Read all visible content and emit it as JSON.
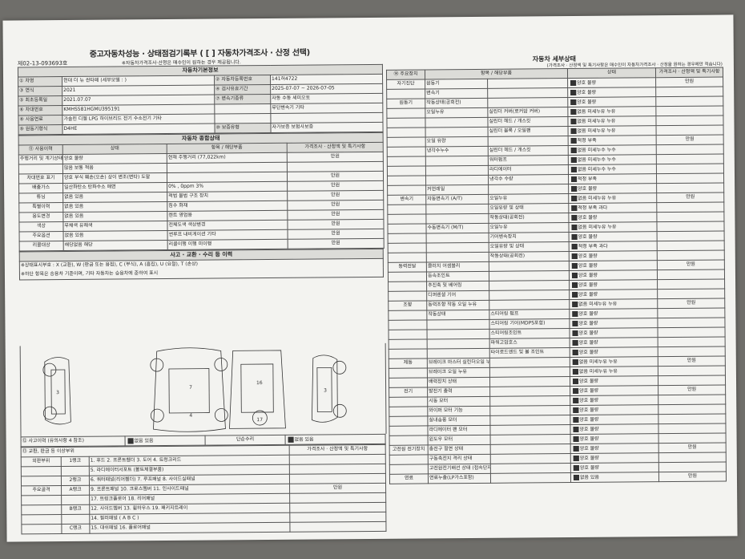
{
  "title": "중고자동차성능 · 상태점검기록부 ( [ ] 자동차가격조사 · 산정 선택)",
  "doc_no": "제02-13-093693호",
  "doc_note": "※자동차가격조사·산정은 매수인이 원하는 경우 제공됩니다.",
  "basic": {
    "header": "자동차기본정보",
    "rows": [
      [
        "① 차명",
        "현대 더 뉴 싼타페 (세부모델 : )",
        "② 자동차등록번호",
        "141허4722"
      ],
      [
        "③ 연식",
        "2021",
        "④ 검사유효기간",
        "2025-07-07 ~ 2026-07-05"
      ],
      [
        "⑤ 최초등록일",
        "2021.07.07",
        "⑦ 변속기종류",
        "자동 수동 세미오토"
      ],
      [
        "⑥ 차대번호",
        "KMHS581HGMU395191",
        "",
        "무단변속기 기타"
      ],
      [
        "⑧ 사용연료",
        "가솔린 디젤 LPG 하이브리드 전기 수소전기 기타",
        "",
        ""
      ],
      [
        "⑨ 원동기형식",
        "D4HE",
        "⑩ 보증유형",
        "자가보증 보험사보증"
      ]
    ]
  },
  "overall": {
    "header": "자동차 종합상태",
    "col_headers": [
      "⑪ 사용이력",
      "상태",
      "항목 / 해당부품",
      "가격조사 · 산정액 및 특기사항"
    ],
    "rows": [
      [
        "주행거리 및 계기상태",
        "양호 불량",
        "현재 주행거리 (77,022km)",
        "만원"
      ],
      [
        "",
        "많음 보통 적음",
        "",
        ""
      ],
      [
        "차대번호 표기",
        "양호 부식 훼손(오손) 상이 변조(변타) 도말",
        "",
        "만원"
      ],
      [
        "배출가스",
        "일산화탄소 탄화수소 매연",
        "0% , 0ppm 3%",
        "만원"
      ],
      [
        "튜닝",
        "없음 있음",
        "적법 불법 구조 장치",
        "만원"
      ],
      [
        "특별이력",
        "없음 있음",
        "침수 화재",
        "만원"
      ],
      [
        "용도변경",
        "없음 있음",
        "렌트 영업용",
        "만원"
      ],
      [
        "색상",
        "무채색 유채색",
        "전체도색 색상변경",
        "만원"
      ],
      [
        "주요옵션",
        "없음 있음",
        "썬루프 내비게이션 기타",
        "만원"
      ],
      [
        "리콜대상",
        "해당없음 해당",
        "리콜이행 이행 미이행",
        "만원"
      ]
    ]
  },
  "accident": {
    "header": "사고 · 교환 · 수리 등 이력",
    "legend1": "※상태표시부호 : X (교환), W (판금 또는 용접), C (부식), A (흠집), U (요철), T (손상)",
    "legend2": "※하단 항목은 승용차 기준이며, 기타 자동차는 승용차에 준하여 표시",
    "accident_history": "⑫ 사고이력 (유의사항 4 참조)",
    "simple_repair": "단순수리",
    "sel": "없음 있음",
    "exterior_header": "⑬ 교환, 판금 등 이상부위",
    "price_header": "가격조사 · 산정액 및 특기사항",
    "rows": [
      [
        "외판부위",
        "1랭크",
        "1. 후드 2. 프론트휀더 3. 도어 4. 트렁크리드"
      ],
      [
        "",
        "",
        "5. 라디에이터서포트 (볼트체결부품)"
      ],
      [
        "",
        "2랭크",
        "6. 쿼터패널(리어휀더) 7. 루프패널 8. 사이드실패널"
      ],
      [
        "주요골격",
        "A랭크",
        "9. 프론트패널 10. 크로스멤버 11. 인사이드패널"
      ],
      [
        "",
        "",
        "17. 트렁크플로어 18. 리어패널"
      ],
      [
        "",
        "B랭크",
        "12. 사이드멤버 13. 휠하우스 19. 패키지트레이"
      ],
      [
        "",
        "",
        "14. 필러패널 ( A B C )"
      ],
      [
        "",
        "C랭크",
        "15. 대쉬패널 16. 플로어패널"
      ]
    ],
    "price": "만원"
  },
  "detail": {
    "header": "자동차 세부상태",
    "subnote": "(가격조사 · 산정액 및 특기사항은 매수인이 자동차가격조사 · 산정을 원하는 경우에만 적습니다)",
    "col_headers": [
      "⑭ 주요장치",
      "항목 / 해당부품",
      "상태",
      "가격조사 · 산정액 및 특기사항"
    ],
    "rows": [
      [
        "자기진단",
        "원동기",
        "",
        "양호 불량",
        "만원"
      ],
      [
        "",
        "변속기",
        "",
        "양호 불량",
        ""
      ],
      [
        "원동기",
        "작동상태(공회전)",
        "",
        "양호 불량",
        ""
      ],
      [
        "",
        "오일누유",
        "실린더 커버(로커암 커버)",
        "없음 미세누유 누유",
        ""
      ],
      [
        "",
        "",
        "실린더 헤드 / 개스킷",
        "없음 미세누유 누유",
        ""
      ],
      [
        "",
        "",
        "실린더 블록 / 오일팬",
        "없음 미세누유 누유",
        ""
      ],
      [
        "",
        "오일 유량",
        "",
        "적정 부족",
        "만원"
      ],
      [
        "",
        "냉각수누수",
        "실린더 헤드 / 개스킷",
        "없음 미세누수 누수",
        ""
      ],
      [
        "",
        "",
        "워터펌프",
        "없음 미세누수 누수",
        ""
      ],
      [
        "",
        "",
        "라디에이터",
        "없음 미세누수 누수",
        ""
      ],
      [
        "",
        "",
        "냉각수 수량",
        "적정 부족",
        ""
      ],
      [
        "",
        "커먼레일",
        "",
        "양호 불량",
        ""
      ],
      [
        "변속기",
        "자동변속기 (A/T)",
        "오일누유",
        "없음 미세누유 누유",
        "만원"
      ],
      [
        "",
        "",
        "오일유량 및 상태",
        "적정 부족 과다",
        ""
      ],
      [
        "",
        "",
        "작동상태(공회전)",
        "양호 불량",
        ""
      ],
      [
        "",
        "수동변속기 (M/T)",
        "오일누유",
        "없음 미세누유 누유",
        ""
      ],
      [
        "",
        "",
        "기어변속장치",
        "양호 불량",
        ""
      ],
      [
        "",
        "",
        "오일유량 및 상태",
        "적정 부족 과다",
        ""
      ],
      [
        "",
        "",
        "작동상태(공회전)",
        "양호 불량",
        ""
      ],
      [
        "동력전달",
        "클러치 어셈블리",
        "",
        "양호 불량",
        "만원"
      ],
      [
        "",
        "등속조인트",
        "",
        "양호 불량",
        ""
      ],
      [
        "",
        "추진축 및 베어링",
        "",
        "양호 불량",
        ""
      ],
      [
        "",
        "디퍼렌셜 기어",
        "",
        "양호 불량",
        ""
      ],
      [
        "조향",
        "동력조향 작동 오일 누유",
        "",
        "없음 미세누유 누유",
        "만원"
      ],
      [
        "",
        "작동상태",
        "스티어링 펌프",
        "양호 불량",
        ""
      ],
      [
        "",
        "",
        "스티어링 기어(MDPS포함)",
        "양호 불량",
        ""
      ],
      [
        "",
        "",
        "스티어링조인트",
        "양호 불량",
        ""
      ],
      [
        "",
        "",
        "파워고압호스",
        "양호 불량",
        ""
      ],
      [
        "",
        "",
        "타이로드엔드 및 볼 조인트",
        "양호 불량",
        ""
      ],
      [
        "제동",
        "브레이크 마스터 실린더오일 누유",
        "",
        "없음 미세누유 누유",
        "만원"
      ],
      [
        "",
        "브레이크 오일 누유",
        "",
        "없음 미세누유 누유",
        ""
      ],
      [
        "",
        "배력장치 상태",
        "",
        "양호 불량",
        ""
      ],
      [
        "전기",
        "발전기 출력",
        "",
        "양호 불량",
        "만원"
      ],
      [
        "",
        "시동 모터",
        "",
        "양호 불량",
        ""
      ],
      [
        "",
        "와이퍼 모터 기능",
        "",
        "양호 불량",
        ""
      ],
      [
        "",
        "실내송풍 모터",
        "",
        "양호 불량",
        ""
      ],
      [
        "",
        "라디에이터 팬 모터",
        "",
        "양호 불량",
        ""
      ],
      [
        "",
        "윈도우 모터",
        "",
        "양호 불량",
        ""
      ],
      [
        "고전원 전기장치",
        "충전구 절연 상태",
        "",
        "양호 불량",
        "만원"
      ],
      [
        "",
        "구동축전지 격리 상태",
        "",
        "양호 불량",
        ""
      ],
      [
        "",
        "고전원전기배선 상태 (접속단자, 피복, 보호기구)",
        "",
        "양호 불량",
        ""
      ],
      [
        "연료",
        "연료누출(LP가스포함)",
        "",
        "없음 있음",
        "만원"
      ]
    ]
  }
}
